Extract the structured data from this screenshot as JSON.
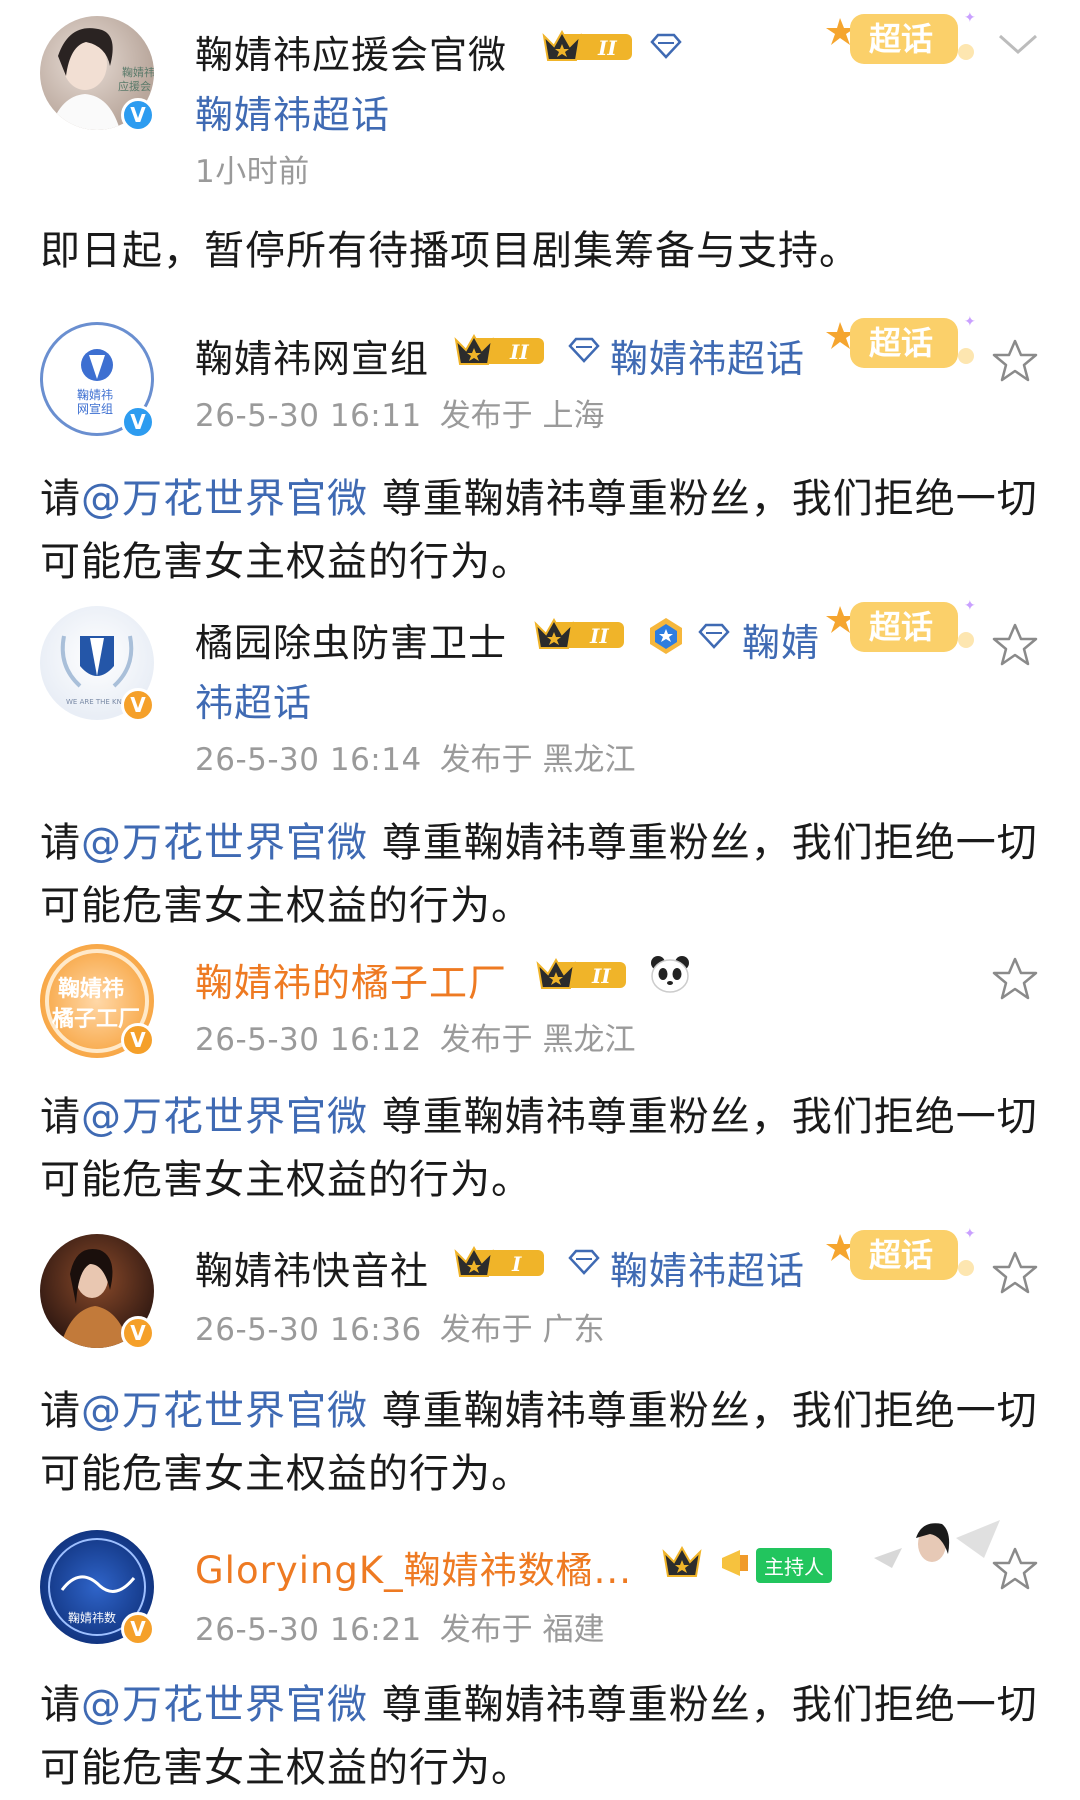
{
  "posts": [
    {
      "name": "鞠婧祎应援会官微",
      "super_topic": "鞠婧祎超话",
      "meta_time": "1小时前",
      "meta_loc": "",
      "body": "即日起，暂停所有待播项目剧集筹备与支持。",
      "avatar_text": "鞠婧祎\n应援会",
      "crown_level": "II"
    },
    {
      "name": "鞠婧祎网宣组",
      "super_topic": "鞠婧祎超话",
      "meta_time": "26-5-30 16:11",
      "meta_loc": "发布于 上海",
      "body_prefix": "请",
      "mention": "@万花世界官微",
      "body_suffix": " 尊重鞠婧祎尊重粉丝，我们拒绝一切可能危害女主权益的行为。",
      "avatar_text": "鞠婧祎\n网宣组",
      "crown_level": "II"
    },
    {
      "name": "橘园除虫防害卫士",
      "super_topic_line1": "鞠婧",
      "super_topic_line2": "祎超话",
      "meta_time": "26-5-30 16:14",
      "meta_loc": "发布于 黑龙江",
      "body_prefix": "请",
      "mention": "@万花世界官微",
      "body_suffix": " 尊重鞠婧祎尊重粉丝，我们拒绝一切可能危害女主权益的行为。",
      "avatar_text": "WE ARE THE KNZ",
      "crown_level": "II"
    },
    {
      "name": "鞠婧祎的橘子工厂",
      "meta_time": "26-5-30 16:12",
      "meta_loc": "发布于 黑龙江",
      "body_prefix": "请",
      "mention": "@万花世界官微",
      "body_suffix": " 尊重鞠婧祎尊重粉丝，我们拒绝一切可能危害女主权益的行为。",
      "avatar_text": "鞠婧祎\n橘子工厂",
      "crown_level": "II"
    },
    {
      "name": "鞠婧祎快音社",
      "super_topic": "鞠婧祎超话",
      "meta_time": "26-5-30 16:36",
      "meta_loc": "发布于 广东",
      "body_prefix": "请",
      "mention": "@万花世界官微",
      "body_suffix": " 尊重鞠婧祎尊重粉丝，我们拒绝一切可能危害女主权益的行为。",
      "crown_level": "I"
    },
    {
      "name": "GloryingK_鞠婧祎数橘...",
      "host_tag": "主持人",
      "meta_time": "26-5-30 16:21",
      "meta_loc": "发布于 福建",
      "body_prefix": "请",
      "mention": "@万花世界官微",
      "body_suffix": " 尊重鞠婧祎尊重粉丝，我们拒绝一切可能危害女主权益的行为。",
      "avatar_text": "鞠婧祎数"
    }
  ],
  "badges": {
    "chaohua": "超话",
    "v": "V"
  },
  "colors": {
    "link_blue": "#3f6ab3",
    "orange_name": "#ee7a22",
    "meta_gray": "#9a9a9a",
    "gold": "#f0b429"
  }
}
